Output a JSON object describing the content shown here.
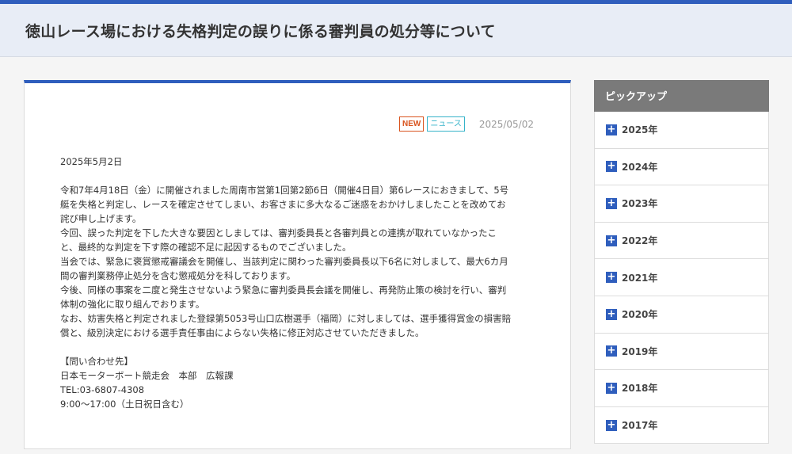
{
  "header": {
    "title": "徳山レース場における失格判定の誤りに係る審判員の処分等について"
  },
  "article": {
    "badge_new": "NEW",
    "category": "ニュース",
    "date": "2025/05/02",
    "lines": [
      "2025年5月2日",
      "",
      "令和7年4月18日（金）に開催されました周南市営第1回第2節6日（開催4日目）第6レースにおきまして、5号",
      "艇を失格と判定し、レースを確定させてしまい、お客さまに多大なるご迷惑をおかけしましたことを改めてお",
      "詫び申し上げます。",
      "今回、誤った判定を下した大きな要因としましては、審判委員長と各審判員との連携が取れていなかったこ",
      "と、最終的な判定を下す際の確認不足に起因するものでございました。",
      "当会では、緊急に褒賞懲戒審議会を開催し、当該判定に関わった審判委員長以下6名に対しまして、最大6カ月",
      "間の審判業務停止処分を含む懲戒処分を科しております。",
      "今後、同様の事案を二度と発生させないよう緊急に審判委員長会議を開催し、再発防止策の検討を行い、審判",
      "体制の強化に取り組んでおります。",
      "なお、妨害失格と判定されました登録第5053号山口広樹選手（福岡）に対しましては、選手獲得賞金の損害賠",
      "償と、級別決定における選手責任事由によらない失格に修正対応させていただきました。",
      "",
      "【問い合わせ先】",
      "日本モーターボート競走会　本部　広報課",
      "TEL:03-6807-4308",
      "9:00～17:00（土日祝日含む）"
    ]
  },
  "sidebar": {
    "heading": "ピックアップ",
    "expand_icon": "plus-icon",
    "years": [
      "2025年",
      "2024年",
      "2023年",
      "2022年",
      "2021年",
      "2020年",
      "2019年",
      "2018年",
      "2017年"
    ]
  },
  "colors": {
    "accent": "#2f5ebd",
    "new_badge": "#d9541e",
    "category_badge": "#36b3c9"
  }
}
